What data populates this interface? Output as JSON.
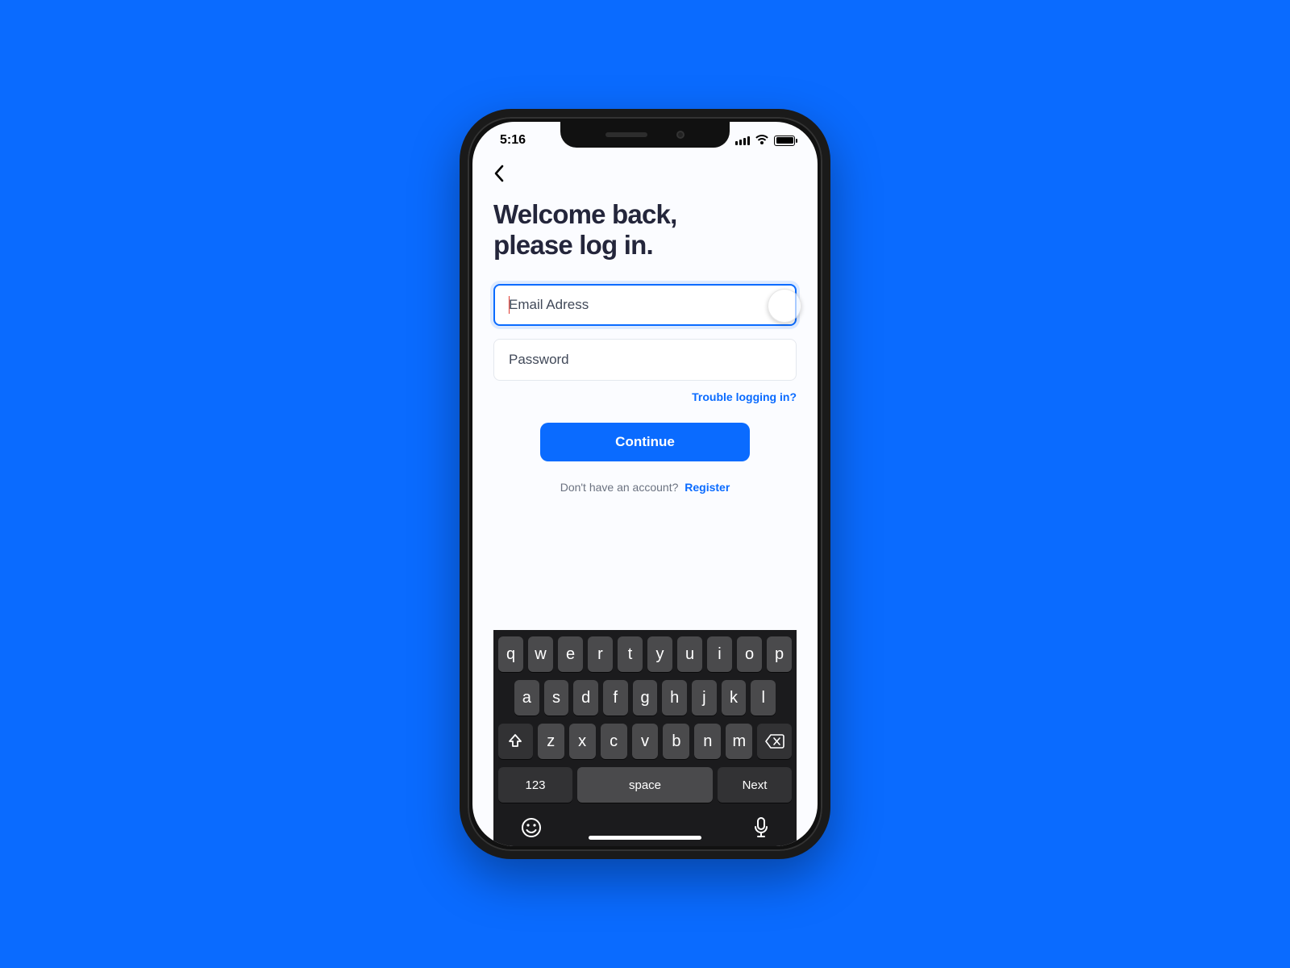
{
  "status": {
    "time": "5:16"
  },
  "title": "Welcome back,\nplease log in.",
  "email": {
    "placeholder": "Email Adress",
    "value": ""
  },
  "password": {
    "placeholder": "Password",
    "value": ""
  },
  "trouble_link": "Trouble logging in?",
  "continue_label": "Continue",
  "register_prompt": "Don't have an account?",
  "register_link": "Register",
  "keyboard": {
    "row1": [
      "q",
      "w",
      "e",
      "r",
      "t",
      "y",
      "u",
      "i",
      "o",
      "p"
    ],
    "row2": [
      "a",
      "s",
      "d",
      "f",
      "g",
      "h",
      "j",
      "k",
      "l"
    ],
    "row3": [
      "z",
      "x",
      "c",
      "v",
      "b",
      "n",
      "m"
    ],
    "numbers": "123",
    "space": "space",
    "next": "Next"
  },
  "colors": {
    "accent": "#0a6bff",
    "bg": "#0a6bff",
    "title": "#24263b"
  }
}
